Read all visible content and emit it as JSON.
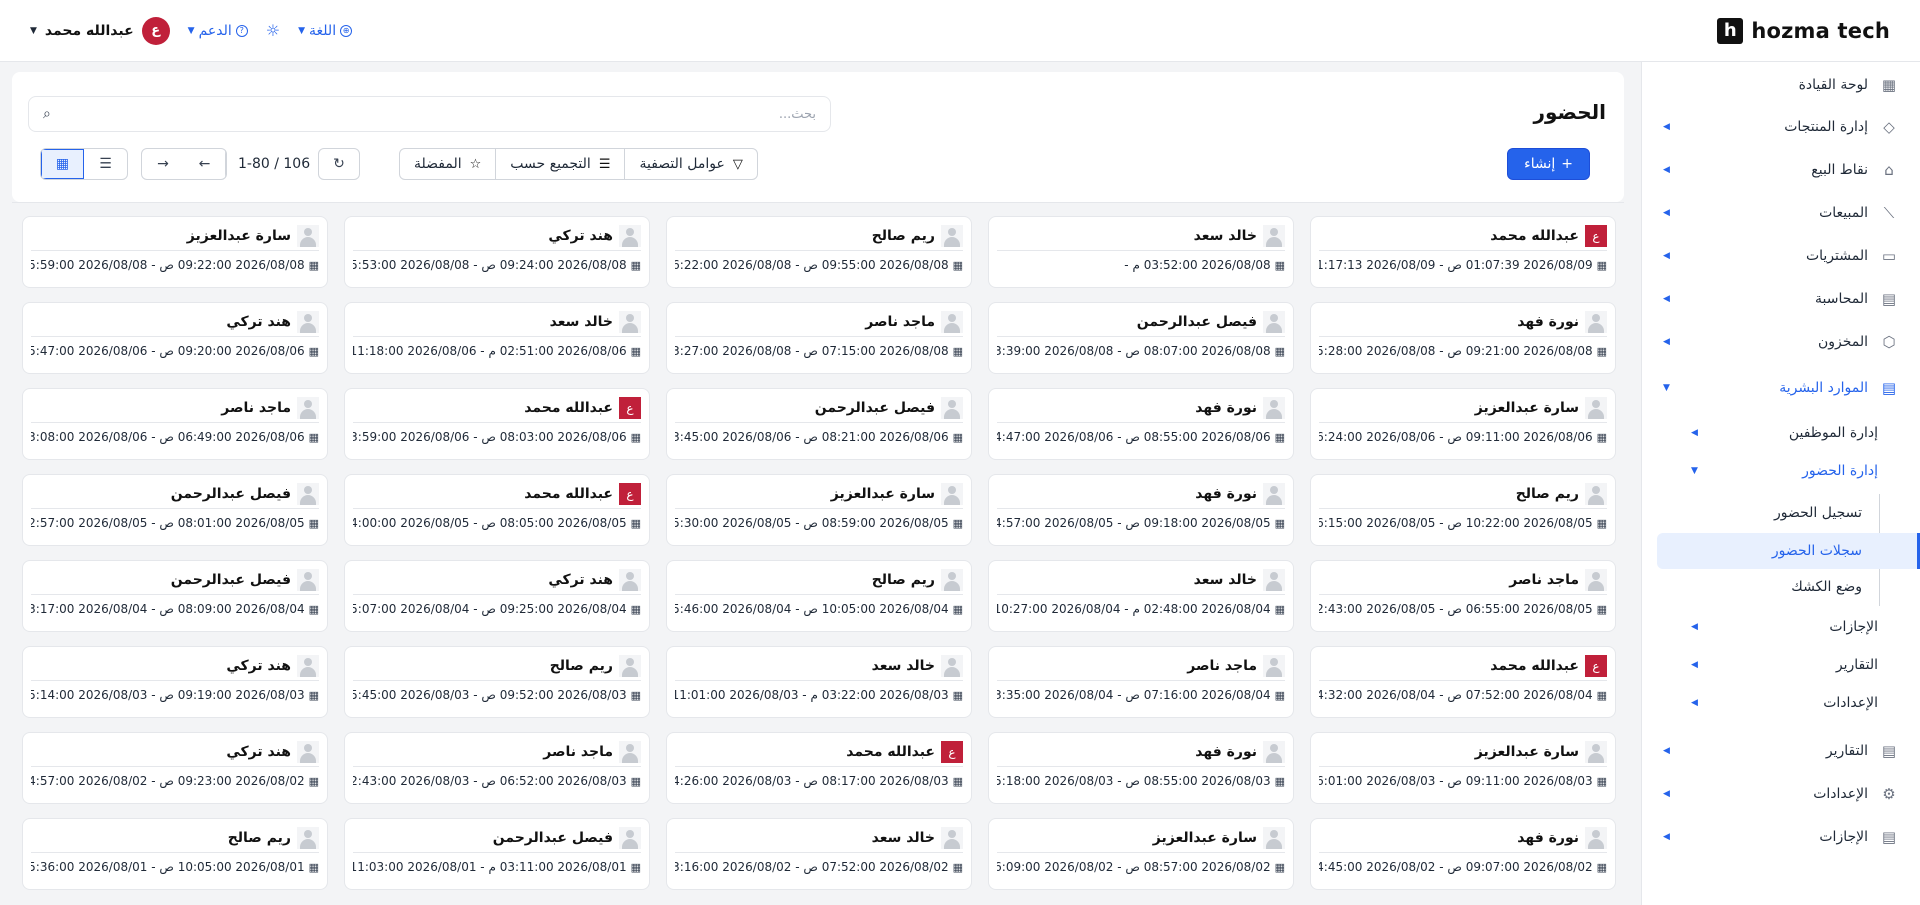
{
  "brand": {
    "name": "hozma tech",
    "logo_letter": "h"
  },
  "topbar": {
    "user_name": "عبدالله محمد",
    "user_initial": "ع",
    "support_label": "الدعم",
    "language_label": "اللغة"
  },
  "sidebar": {
    "items": [
      {
        "label": "لوحة القيادة",
        "icon": "dashboard-icon"
      },
      {
        "label": "إدارة المنتجات",
        "icon": "tag-icon"
      },
      {
        "label": "نقاط البيع",
        "icon": "store-icon"
      },
      {
        "label": "المبيعات",
        "icon": "chart-icon"
      },
      {
        "label": "المشتريات",
        "icon": "wallet-icon"
      },
      {
        "label": "المحاسبة",
        "icon": "ledger-icon"
      },
      {
        "label": "المخزون",
        "icon": "box-icon"
      },
      {
        "label": "الموارد البشرية",
        "icon": "document-icon"
      },
      {
        "label": "إدارة الموظفين"
      },
      {
        "label": "إدارة الحضور"
      },
      {
        "label": "تسجيل الحضور"
      },
      {
        "label": "سجلات الحضور"
      },
      {
        "label": "وضع الكشك"
      },
      {
        "label": "الإجازات"
      },
      {
        "label": "التقارير"
      },
      {
        "label": "الإعدادات"
      },
      {
        "label": "التقارير",
        "icon": "report-icon"
      },
      {
        "label": "الإعدادات",
        "icon": "gear-icon"
      },
      {
        "label": "الإجازات",
        "icon": "leave-icon"
      }
    ]
  },
  "main": {
    "title": "الحضور",
    "search_placeholder": "بحث...",
    "create_label": "إنشاء",
    "filters_label": "عوامل التصفية",
    "group_by_label": "التجميع حسب",
    "favorites_label": "المفضلة",
    "pager_text": "1-80 / 106"
  },
  "records": [
    {
      "name": "عبدالله محمد",
      "avatar": "initial",
      "initial": "ع",
      "time": "2026/08/09 01:07:39 ص - 2026/08/09 01:17:13 ص"
    },
    {
      "name": "خالد سعد",
      "avatar": "placeholder",
      "time": "2026/08/08 03:52:00 م -"
    },
    {
      "name": "ريم صالح",
      "avatar": "placeholder",
      "time": "2026/08/08 09:55:00 ص - 2026/08/08 06:22:00 م"
    },
    {
      "name": "هند تركي",
      "avatar": "placeholder",
      "time": "2026/08/08 09:24:00 ص - 2026/08/08 05:53:00 م"
    },
    {
      "name": "سارة عبدالعزيز",
      "avatar": "placeholder",
      "time": "2026/08/08 09:22:00 ص - 2026/08/08 05:59:00 م"
    },
    {
      "name": "نورة فهد",
      "avatar": "placeholder",
      "time": "2026/08/08 09:21:00 ص - 2026/08/08 05:28:00 م"
    },
    {
      "name": "فيصل عبدالرحمن",
      "avatar": "placeholder",
      "time": "2026/08/08 08:07:00 ص - 2026/08/08 03:39:00 م"
    },
    {
      "name": "ماجد ناصر",
      "avatar": "placeholder",
      "time": "2026/08/08 07:15:00 ص - 2026/08/08 03:27:00 م"
    },
    {
      "name": "خالد سعد",
      "avatar": "placeholder",
      "time": "2026/08/06 02:51:00 م - 2026/08/06 11:18:00 م"
    },
    {
      "name": "هند تركي",
      "avatar": "placeholder",
      "time": "2026/08/06 09:20:00 ص - 2026/08/06 05:47:00 م"
    },
    {
      "name": "سارة عبدالعزيز",
      "avatar": "placeholder",
      "time": "2026/08/06 09:11:00 ص - 2026/08/06 06:24:00 م"
    },
    {
      "name": "نورة فهد",
      "avatar": "placeholder",
      "time": "2026/08/06 08:55:00 ص - 2026/08/06 04:47:00 م"
    },
    {
      "name": "فيصل عبدالرحمن",
      "avatar": "placeholder",
      "time": "2026/08/06 08:21:00 ص - 2026/08/06 03:45:00 م"
    },
    {
      "name": "عبدالله محمد",
      "avatar": "initial",
      "initial": "ع",
      "time": "2026/08/06 08:03:00 ص - 2026/08/06 03:59:00 م"
    },
    {
      "name": "ماجد ناصر",
      "avatar": "placeholder",
      "time": "2026/08/06 06:49:00 ص - 2026/08/06 03:08:00 م"
    },
    {
      "name": "ريم صالح",
      "avatar": "placeholder",
      "time": "2026/08/05 10:22:00 ص - 2026/08/05 06:15:00 م"
    },
    {
      "name": "نورة فهد",
      "avatar": "placeholder",
      "time": "2026/08/05 09:18:00 ص - 2026/08/05 04:57:00 م"
    },
    {
      "name": "سارة عبدالعزيز",
      "avatar": "placeholder",
      "time": "2026/08/05 08:59:00 ص - 2026/08/05 05:30:00 م"
    },
    {
      "name": "عبدالله محمد",
      "avatar": "initial",
      "initial": "ع",
      "time": "2026/08/05 08:05:00 ص - 2026/08/05 04:00:00 م"
    },
    {
      "name": "فيصل عبدالرحمن",
      "avatar": "placeholder",
      "time": "2026/08/05 08:01:00 ص - 2026/08/05 02:57:00 م"
    },
    {
      "name": "ماجد ناصر",
      "avatar": "placeholder",
      "time": "2026/08/05 06:55:00 ص - 2026/08/05 02:43:00 م"
    },
    {
      "name": "خالد سعد",
      "avatar": "placeholder",
      "time": "2026/08/04 02:48:00 م - 2026/08/04 10:27:00 م"
    },
    {
      "name": "ريم صالح",
      "avatar": "placeholder",
      "time": "2026/08/04 10:05:00 ص - 2026/08/04 05:46:00 م"
    },
    {
      "name": "هند تركي",
      "avatar": "placeholder",
      "time": "2026/08/04 09:25:00 ص - 2026/08/04 05:07:00 م"
    },
    {
      "name": "فيصل عبدالرحمن",
      "avatar": "placeholder",
      "time": "2026/08/04 08:09:00 ص - 2026/08/04 03:17:00 م"
    },
    {
      "name": "عبدالله محمد",
      "avatar": "initial",
      "initial": "ع",
      "time": "2026/08/04 07:52:00 ص - 2026/08/04 04:32:00 م"
    },
    {
      "name": "ماجد ناصر",
      "avatar": "placeholder",
      "time": "2026/08/04 07:16:00 ص - 2026/08/04 03:35:00 م"
    },
    {
      "name": "خالد سعد",
      "avatar": "placeholder",
      "time": "2026/08/03 03:22:00 م - 2026/08/03 11:01:00 م"
    },
    {
      "name": "ريم صالح",
      "avatar": "placeholder",
      "time": "2026/08/03 09:52:00 ص - 2026/08/03 05:45:00 م"
    },
    {
      "name": "هند تركي",
      "avatar": "placeholder",
      "time": "2026/08/03 09:19:00 ص - 2026/08/03 05:14:00 م"
    },
    {
      "name": "سارة عبدالعزيز",
      "avatar": "placeholder",
      "time": "2026/08/03 09:11:00 ص - 2026/08/03 06:01:00 م"
    },
    {
      "name": "نورة فهد",
      "avatar": "placeholder",
      "time": "2026/08/03 08:55:00 ص - 2026/08/03 05:18:00 م"
    },
    {
      "name": "عبدالله محمد",
      "avatar": "initial",
      "initial": "ع",
      "time": "2026/08/03 08:17:00 ص - 2026/08/03 04:26:00 م"
    },
    {
      "name": "ماجد ناصر",
      "avatar": "placeholder",
      "time": "2026/08/03 06:52:00 ص - 2026/08/03 02:43:00 م"
    },
    {
      "name": "هند تركي",
      "avatar": "placeholder",
      "time": "2026/08/02 09:23:00 ص - 2026/08/02 04:57:00 م"
    },
    {
      "name": "نورة فهد",
      "avatar": "placeholder",
      "time": "2026/08/02 09:07:00 ص - 2026/08/02 04:45:00 م"
    },
    {
      "name": "سارة عبدالعزيز",
      "avatar": "placeholder",
      "time": "2026/08/02 08:57:00 ص - 2026/08/02 06:09:00 م"
    },
    {
      "name": "خالد سعد",
      "avatar": "placeholder",
      "time": "2026/08/02 07:52:00 ص - 2026/08/02 03:16:00 م"
    },
    {
      "name": "فيصل عبدالرحمن",
      "avatar": "placeholder",
      "time": "2026/08/01 03:11:00 م - 2026/08/01 11:03:00 م"
    },
    {
      "name": "ريم صالح",
      "avatar": "placeholder",
      "time": "2026/08/01 10:05:00 ص - 2026/08/01 05:36:00 م"
    }
  ]
}
